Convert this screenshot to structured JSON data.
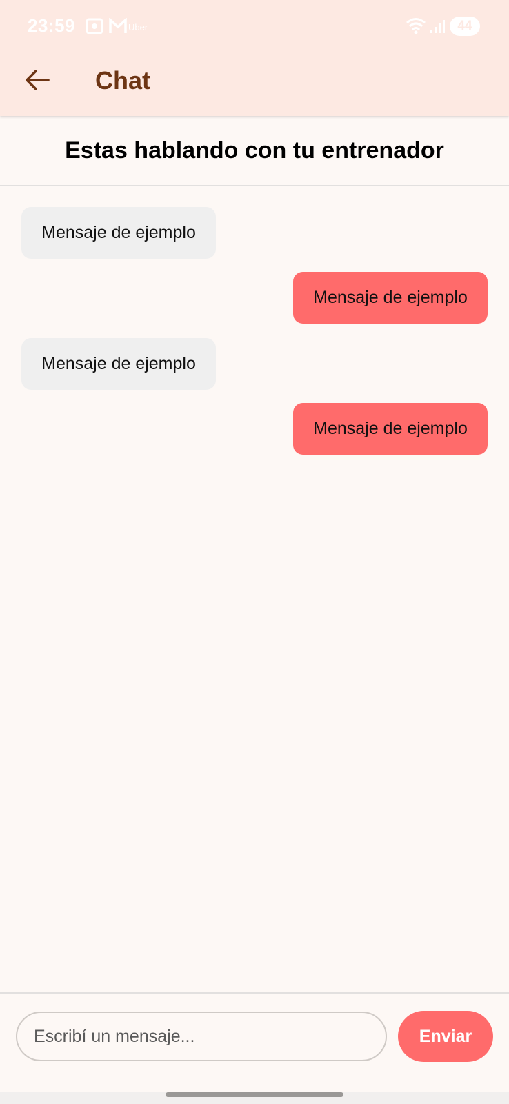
{
  "status_bar": {
    "time": "23:59",
    "notification_label": "Uber",
    "battery": "44"
  },
  "app_bar": {
    "title": "Chat",
    "back_icon": "arrow-back-icon"
  },
  "header": {
    "text": "Estas hablando con tu entrenador"
  },
  "messages": [
    {
      "direction": "received",
      "text": "Mensaje de ejemplo"
    },
    {
      "direction": "sent",
      "text": "Mensaje de ejemplo"
    },
    {
      "direction": "received",
      "text": "Mensaje de ejemplo"
    },
    {
      "direction": "sent",
      "text": "Mensaje de ejemplo"
    }
  ],
  "composer": {
    "placeholder": "Escribí un mensaje...",
    "value": "",
    "send_label": "Enviar"
  },
  "colors": {
    "app_bar_bg": "#fde9e2",
    "title": "#6d3514",
    "sent_bubble": "#ff6b6b",
    "received_bubble": "#efefef",
    "background": "#fdf8f5"
  }
}
